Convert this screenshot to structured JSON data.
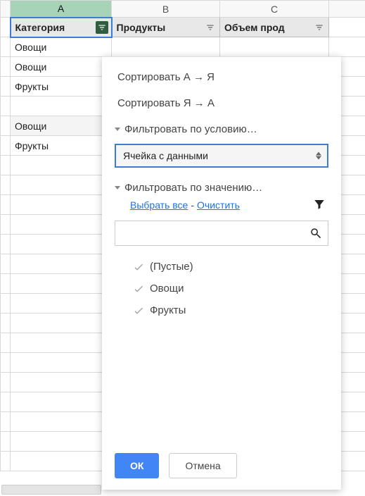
{
  "columns": {
    "A": "A",
    "B": "B",
    "C": "C"
  },
  "headers": {
    "A": "Категория",
    "B": "Продукты",
    "C": "Объем прод"
  },
  "rows": [
    "Овощи",
    "Овощи",
    "Фрукты",
    "",
    "Овощи",
    "Фрукты"
  ],
  "popup": {
    "sort_az": "Сортировать А → Я",
    "sort_za": "Сортировать Я → А",
    "filter_by_condition": "Фильтровать по условию…",
    "condition_selected": "Ячейка с данными",
    "filter_by_value": "Фильтровать по значению…",
    "select_all": "Выбрать все",
    "clear": "Очистить",
    "values": [
      "(Пустые)",
      "Овощи",
      "Фрукты"
    ],
    "ok": "ОК",
    "cancel": "Отмена"
  }
}
